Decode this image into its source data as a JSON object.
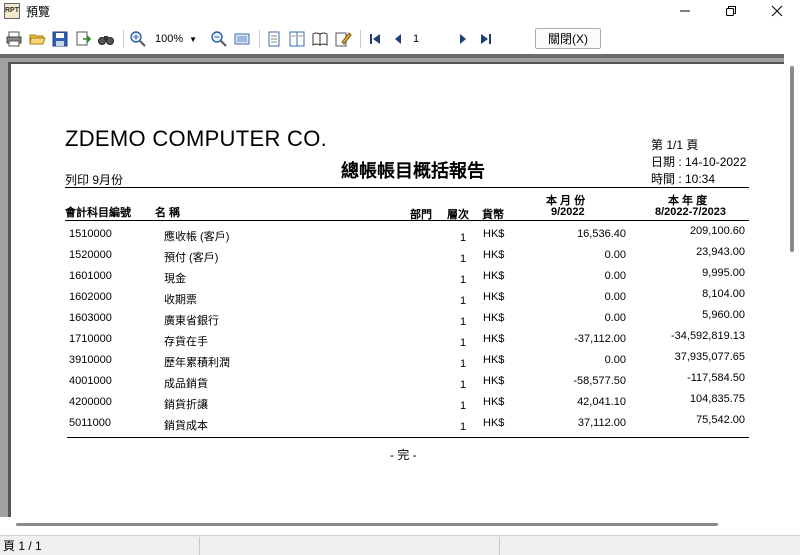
{
  "window": {
    "title": "預覽",
    "app_icon_text": "RPT"
  },
  "toolbar": {
    "icons": [
      "print-icon",
      "open-folder-icon",
      "save-icon",
      "export-icon",
      "find-icon",
      "zoom-in-icon",
      "zoom-out-icon",
      "fit-page-icon",
      "one-page-icon",
      "two-page-icon",
      "book-icon",
      "edit-icon",
      "first-page-icon",
      "prev-page-icon",
      "next-page-icon",
      "last-page-icon"
    ],
    "zoom_value": "100%",
    "page_value": "1",
    "close_label": "關閉(X)"
  },
  "report": {
    "company": "ZDEMO COMPUTER CO.",
    "title": "總帳帳目概括報告",
    "page_info": "第 1/1 頁",
    "date_info": "日期 : 14-10-2022",
    "time_info": "時間 : 10:34",
    "print_label": "列印 9月份",
    "headers": {
      "account_code": "會計科目編號",
      "name": "名 稱",
      "dept": "部門",
      "level": "層次",
      "currency": "貨幣",
      "month": "本 月 份",
      "month_sub": "9/2022",
      "year": "本 年 度",
      "year_sub": "8/2022-7/2023"
    },
    "rows": [
      {
        "code": "1510000",
        "name": "應收帳 (客戶)",
        "level": "1",
        "currency": "HK$",
        "month": "16,536.40",
        "year": "209,100.60"
      },
      {
        "code": "1520000",
        "name": "預付 (客戶)",
        "level": "1",
        "currency": "HK$",
        "month": "0.00",
        "year": "23,943.00"
      },
      {
        "code": "1601000",
        "name": "現金",
        "level": "1",
        "currency": "HK$",
        "month": "0.00",
        "year": "9,995.00"
      },
      {
        "code": "1602000",
        "name": "收期票",
        "level": "1",
        "currency": "HK$",
        "month": "0.00",
        "year": "8,104.00"
      },
      {
        "code": "1603000",
        "name": "廣東省銀行",
        "level": "1",
        "currency": "HK$",
        "month": "0.00",
        "year": "5,960.00"
      },
      {
        "code": "1710000",
        "name": "存貨在手",
        "level": "1",
        "currency": "HK$",
        "month": "-37,112.00",
        "year": "-34,592,819.13"
      },
      {
        "code": "3910000",
        "name": "歷年累積利潤",
        "level": "1",
        "currency": "HK$",
        "month": "0.00",
        "year": "37,935,077.65"
      },
      {
        "code": "4001000",
        "name": "成品銷貨",
        "level": "1",
        "currency": "HK$",
        "month": "-58,577.50",
        "year": "-117,584.50"
      },
      {
        "code": "4200000",
        "name": "銷貨折讓",
        "level": "1",
        "currency": "HK$",
        "month": "42,041.10",
        "year": "104,835.75"
      },
      {
        "code": "5011000",
        "name": "銷貨成本",
        "level": "1",
        "currency": "HK$",
        "month": "37,112.00",
        "year": "75,542.00"
      }
    ],
    "end_mark": "- 完 -"
  },
  "status": {
    "page_count": "頁 1 / 1"
  }
}
